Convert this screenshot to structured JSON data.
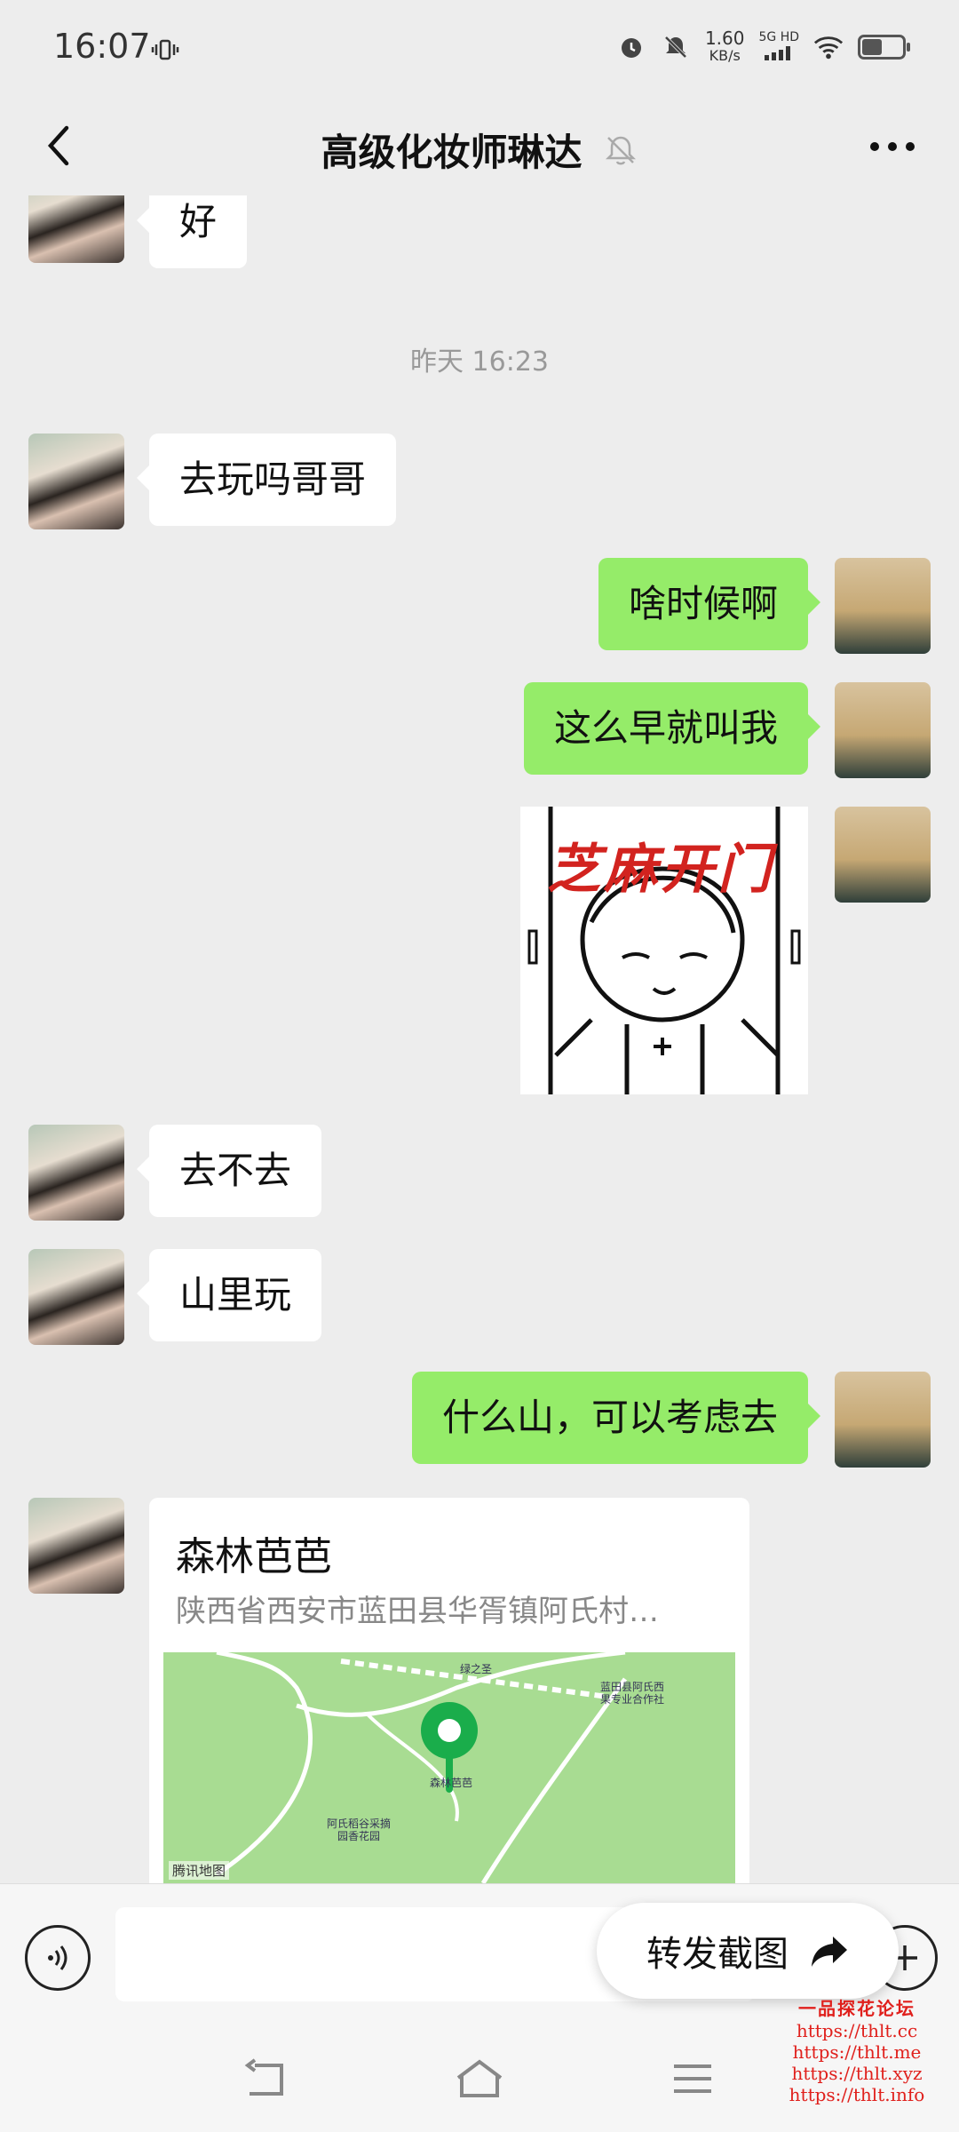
{
  "status_bar": {
    "time": "16:07",
    "speed_value": "1.60",
    "speed_unit": "KB/s",
    "network": "5G HD",
    "icons": [
      "vibrate-icon",
      "alarm-icon",
      "mute-icon",
      "signal-icon",
      "wifi-icon",
      "battery-icon"
    ]
  },
  "header": {
    "title": "高级化妆师琳达",
    "back_icon": "chevron-left-icon",
    "mute_icon": "bell-off-icon",
    "more_icon": "more-dots-icon"
  },
  "chat": {
    "timestamp": "昨天 16:23",
    "messages": [
      {
        "side": "left",
        "type": "text",
        "text": "好"
      },
      {
        "side": "left",
        "type": "text",
        "text": "去玩吗哥哥"
      },
      {
        "side": "right",
        "type": "text",
        "text": "啥时候啊"
      },
      {
        "side": "right",
        "type": "text",
        "text": "这么早就叫我"
      },
      {
        "side": "right",
        "type": "sticker",
        "text": "芝麻开门"
      },
      {
        "side": "left",
        "type": "text",
        "text": "去不去"
      },
      {
        "side": "left",
        "type": "text",
        "text": "山里玩"
      },
      {
        "side": "right",
        "type": "text",
        "text": "什么山，可以考虑去"
      },
      {
        "side": "left",
        "type": "location",
        "name": "森林芭芭",
        "address": "陕西省西安市蓝田县华胥镇阿氏村…"
      }
    ],
    "map": {
      "labels": [
        "绿之圣",
        "蓝田县阿氏西",
        "果专业合作社",
        "森林芭芭",
        "阿氏稻谷采摘",
        "园香花园"
      ],
      "brand": "腾讯地图"
    }
  },
  "input_bar": {
    "voice_icon": "voice-icon",
    "plus_icon": "plus-icon",
    "forward_label": "转发截图",
    "forward_icon": "share-arrow-icon"
  },
  "nav_bar": {
    "icons": [
      "back-nav-icon",
      "home-nav-icon",
      "menu-nav-icon"
    ]
  },
  "watermark": {
    "title": "一品探花论坛",
    "lines": [
      "https://thlt.cc",
      "https://thlt.me",
      "https://thlt.xyz",
      "https://thlt.info"
    ]
  },
  "colors": {
    "background": "#ededed",
    "bubble_right": "#95ec69",
    "bubble_left": "#ffffff",
    "map": "#a8dc92",
    "pin": "#1aad4b",
    "watermark": "#e0201c"
  }
}
